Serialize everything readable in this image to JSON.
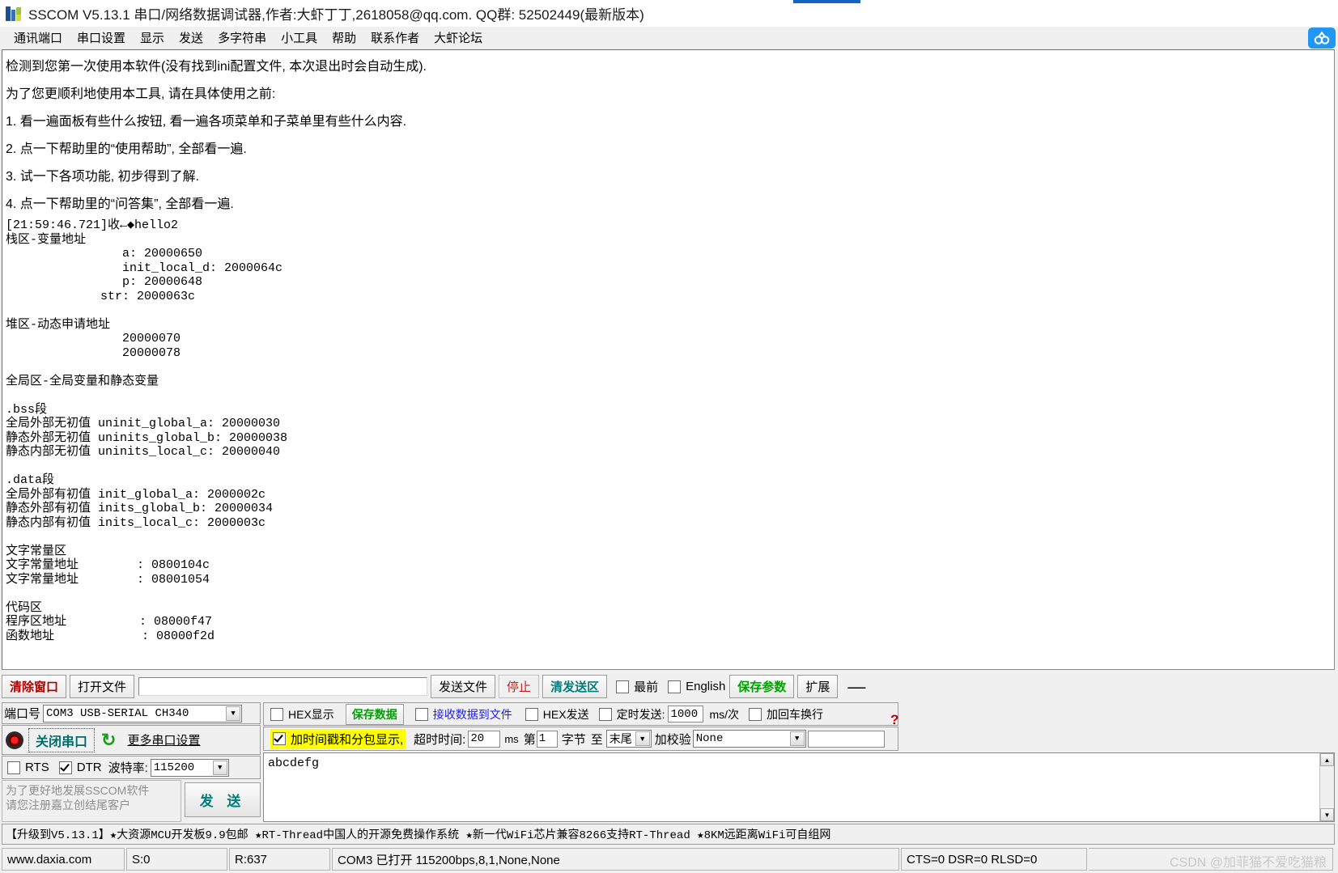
{
  "window": {
    "title": "SSCOM V5.13.1 串口/网络数据调试器,作者:大虾丁丁,2618058@qq.com. QQ群: 52502449(最新版本)",
    "icon": "sscom-app-icon"
  },
  "menu": {
    "items": [
      {
        "label": "通讯端口",
        "name": "menu-comm-port"
      },
      {
        "label": "串口设置",
        "name": "menu-serial-settings"
      },
      {
        "label": "显示",
        "name": "menu-display"
      },
      {
        "label": "发送",
        "name": "menu-send"
      },
      {
        "label": "多字符串",
        "name": "menu-multi-string"
      },
      {
        "label": "小工具",
        "name": "menu-tools"
      },
      {
        "label": "帮助",
        "name": "menu-help"
      },
      {
        "label": "联系作者",
        "name": "menu-contact-author"
      },
      {
        "label": "大虾论坛",
        "name": "menu-forum"
      }
    ],
    "badge_icon": "cloud-link-icon"
  },
  "receive": {
    "intro_lines": [
      "检测到您第一次使用本软件(没有找到ini配置文件, 本次退出时会自动生成).",
      "为了您更顺利地使用本工具, 请在具体使用之前:",
      "1. 看一遍面板有些什么按钮, 看一遍各项菜单和子菜单里有些什么内容.",
      "2. 点一下帮助里的“使用帮助”, 全部看一遍.",
      "3. 试一下各项功能, 初步得到了解.",
      "4. 点一下帮助里的“问答集”, 全部看一遍."
    ],
    "log_lines": [
      "[21:59:46.721]收←◆hello2",
      "栈区-变量地址",
      "                a: 20000650",
      "                init_local_d: 2000064c",
      "                p: 20000648",
      "             str: 2000063c",
      "",
      "堆区-动态申请地址",
      "                20000070",
      "                20000078",
      "",
      "全局区-全局变量和静态变量",
      "",
      ".bss段",
      "全局外部无初值 uninit_global_a: 20000030",
      "静态外部无初值 uninits_global_b: 20000038",
      "静态内部无初值 uninits_local_c: 20000040",
      "",
      ".data段",
      "全局外部有初值 init_global_a: 2000002c",
      "静态外部有初值 inits_global_b: 20000034",
      "静态内部有初值 inits_local_c: 2000003c",
      "",
      "文字常量区",
      "文字常量地址        : 0800104c",
      "文字常量地址        : 08001054",
      "",
      "代码区",
      "程序区地址          : 08000f47",
      "函数地址            : 08000f2d"
    ]
  },
  "sendbar": {
    "clear_window": "清除窗口",
    "open_file": "打开文件",
    "file_path_value": "",
    "send_file": "发送文件",
    "stop": "停止",
    "clear_send": "清发送区",
    "topmost_label": "最前",
    "topmost_checked": false,
    "english_label": "English",
    "english_checked": false,
    "save_params": "保存参数",
    "extend": "扩展",
    "minimize": "—"
  },
  "port": {
    "port_label": "端口号",
    "port_value": "COM3 USB-SERIAL CH340",
    "close_port_button": "关闭串口",
    "refresh_icon": "refresh-icon",
    "led_icon": "port-status-led",
    "more_settings": "更多串口设置",
    "rts_label": "RTS",
    "rts_checked": false,
    "dtr_label": "DTR",
    "dtr_checked": true,
    "baud_label": "波特率:",
    "baud_value": "115200",
    "promo_line1": "为了更好地发展SSCOM软件",
    "promo_line2": "请您注册嘉立创结尾客户",
    "send_button": "发 送"
  },
  "options": {
    "hex_display_label": "HEX显示",
    "hex_display_checked": false,
    "save_data_button": "保存数据",
    "recv_to_file_label": "接收数据到文件",
    "recv_to_file_checked": false,
    "hex_send_label": "HEX发送",
    "hex_send_checked": false,
    "timed_send_label": "定时发送:",
    "timed_send_checked": false,
    "timed_send_value": "1000",
    "ms_per_time": "ms/次",
    "crlf_label": "加回车换行",
    "crlf_checked": false,
    "timestamp_label": "加时间戳和分包显示,",
    "timestamp_checked": true,
    "timeout_label": "超时时间:",
    "timeout_value": "20",
    "timeout_unit": "ms",
    "byte_prefix": "第",
    "byte_index_value": "1",
    "byte_word": "字节",
    "byte_to": "至",
    "byte_end_value": "末尾",
    "checksum_label": "加校验",
    "checksum_value": "None",
    "checksum_extra_value": "",
    "help_icon": "help-question-icon"
  },
  "send_area": {
    "text": "abcdefg"
  },
  "adbar": {
    "text": "【升级到V5.13.1】★大资源MCU开发板9.9包邮 ★RT-Thread中国人的开源免费操作系统 ★新一代WiFi芯片兼容8266支持RT-Thread ★8KM远距离WiFi可自组网"
  },
  "statusbar": {
    "website": "www.daxia.com",
    "sent": "S:0",
    "received": "R:637",
    "port_status": "COM3 已打开  115200bps,8,1,None,None",
    "signals": "CTS=0 DSR=0 RLSD=0"
  },
  "watermark": {
    "text": "CSDN @加菲猫不爱吃猫粮"
  }
}
